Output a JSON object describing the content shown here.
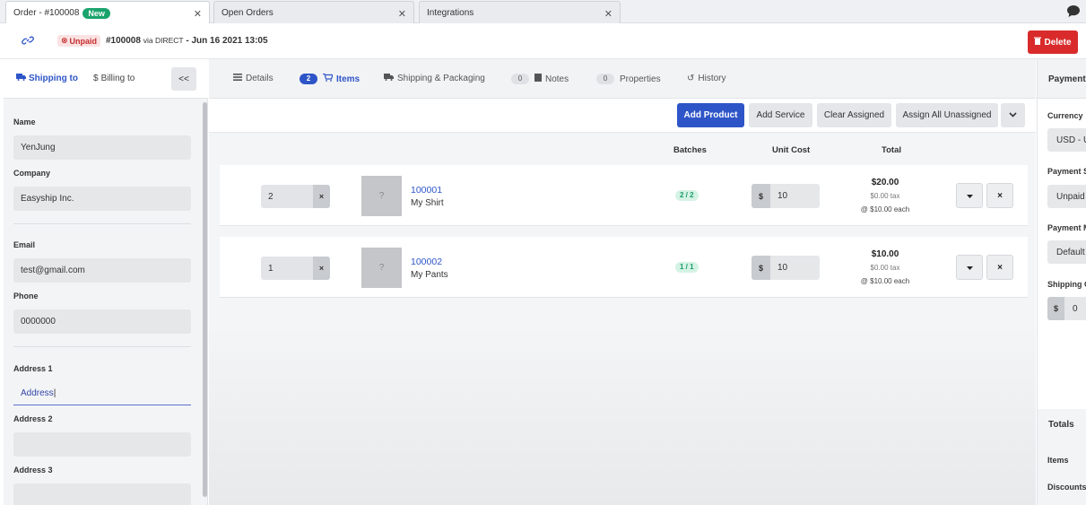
{
  "tabs": [
    {
      "label": "Order - #100008",
      "badge": "New",
      "active": true
    },
    {
      "label": "Open Orders"
    },
    {
      "label": "Integrations"
    }
  ],
  "order": {
    "status": "Unpaid",
    "number": "#100008",
    "via_label": "via DIRECT",
    "date": "- Jun 16 2021 13:05",
    "delete_label": "Delete"
  },
  "left": {
    "tab_shipping": "Shipping to",
    "tab_billing": "Billing to",
    "collapse": "<<",
    "fields": {
      "name_label": "Name",
      "name_value": "YenJung",
      "company_label": "Company",
      "company_value": "Easyship Inc.",
      "email_label": "Email",
      "email_value": "test@gmail.com",
      "phone_label": "Phone",
      "phone_value": "0000000",
      "address1_label": "Address 1",
      "address1_value": "Address",
      "address2_label": "Address 2",
      "address2_value": "",
      "address3_label": "Address 3",
      "address3_value": ""
    }
  },
  "center": {
    "tabs": {
      "details": "Details",
      "items_count": "2",
      "items": "Items",
      "shipping": "Shipping & Packaging",
      "notes_count": "0",
      "notes": "Notes",
      "props_count": "0",
      "properties": "Properties",
      "history": "History"
    },
    "toolbar": {
      "add_product": "Add Product",
      "add_service": "Add Service",
      "clear_assigned": "Clear Assigned",
      "assign_all": "Assign All Unassigned"
    },
    "columns": {
      "batches": "Batches",
      "unit_cost": "Unit Cost",
      "total": "Total"
    },
    "items": [
      {
        "qty": "2",
        "thumb": "?",
        "sku": "100001",
        "name": "My Shirt",
        "batches": "2 / 2",
        "currency": "$",
        "cost": "10",
        "total": "$20.00",
        "tax": "$0.00 tax",
        "each": "@ $10.00 each"
      },
      {
        "qty": "1",
        "thumb": "?",
        "sku": "100002",
        "name": "My Pants",
        "batches": "1 / 1",
        "currency": "$",
        "cost": "10",
        "total": "$10.00",
        "tax": "$0.00 tax",
        "each": "@ $10.00 each"
      }
    ],
    "row_clear": "×"
  },
  "right": {
    "title": "Payment",
    "currency_label": "Currency",
    "currency_value": "USD - U",
    "status_label": "Payment S",
    "status_value": "Unpaid",
    "method_label": "Payment M",
    "method_value": "Default",
    "shipping_label": "Shipping C",
    "shipping_currency": "$",
    "shipping_value": "0",
    "totals_title": "Totals",
    "items_label": "Items",
    "discounts_label": "Discounts"
  },
  "colors": {
    "primary": "#2e55c8",
    "danger": "#d92b2b",
    "success": "#1aa36c"
  }
}
